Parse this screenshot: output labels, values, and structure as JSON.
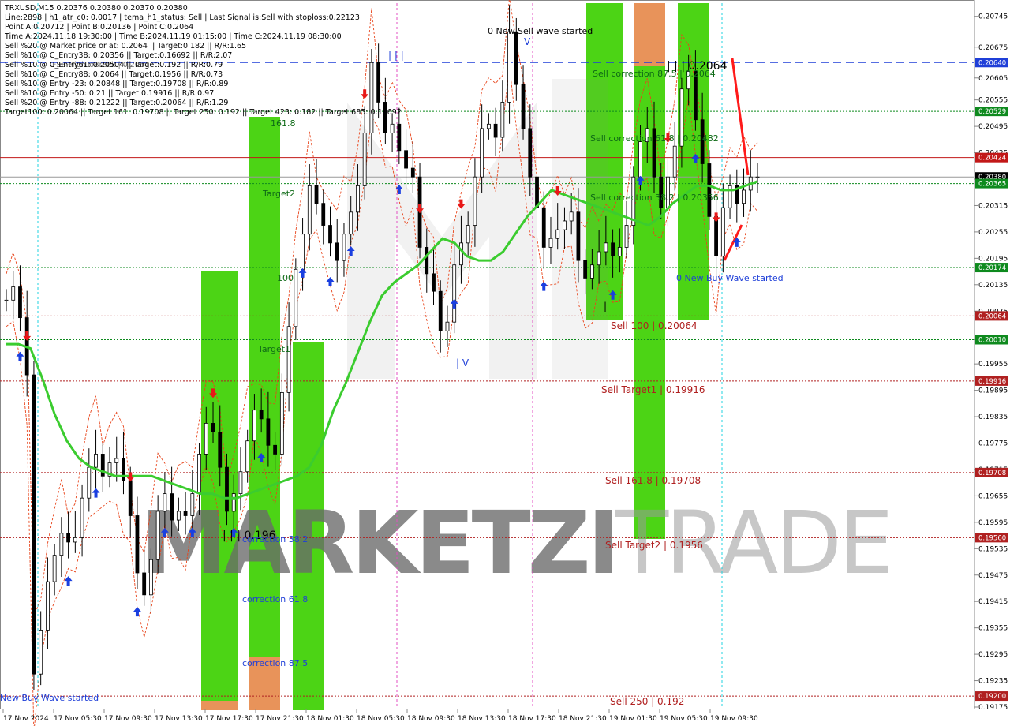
{
  "header": {
    "symbol_line": "TRXUSD,M15  0.20376 0.20380 0.20370 0.20380",
    "info_lines": [
      "Line:2898 | h1_atr_c0: 0.0017 | tema_h1_status: Sell | Last Signal is:Sell with stoploss:0.22123",
      "Point A:0.20712 | Point B:0.20136 | Point C:0.2064",
      "Time A:2024.11.18 19:30:00 | Time B:2024.11.19 01:15:00 | Time C:2024.11.19 08:30:00",
      "Sell %20 @ Market price or at: 0.2064 || Target:0.182 || R/R:1.65",
      "Sell %10 @ C_Entry38: 0.20356 || Target:0.16692 || R/R:2.07",
      "Sell %10 @ C_Entry61: 0.20504 || Target:0.192 || R/R:0.79",
      "Sell %10 @ C_Entry88: 0.2064 || Target:0.1956 || R/R:0.73",
      "Sell %10 @ Entry -23: 0.20848 || Target:0.19708 || R/R:0.89",
      "Sell %10 @ Entry -50: 0.21 || Target:0.19916 || R/R:0.97",
      "Sell %20 @ Entry -88: 0.21222 || Target:0.20064 || R/R:1.29",
      "Target100: 0.20064 || Target 161: 0.19708 || Target 250: 0.192 || Target 423: 0.182 || Target 685: 0.16692"
    ],
    "overlap_text": "FSB-HighToBreak | 0.2064"
  },
  "watermark": {
    "part1": "MARKETZI",
    "part2": "TRADE"
  },
  "colors": {
    "green_zone": "#4cd415",
    "orange_zone": "#e8935a",
    "ema": "#3bcc2f",
    "envelope": "#e8441a",
    "blue_level": "#1f3fd8",
    "red_level": "#c21818",
    "green_level": "#0e8a1e",
    "dark_red_level": "#b02020"
  },
  "price_axis_labels": [
    "0.20745",
    "0.20675",
    "0.20605",
    "0.20555",
    "0.20495",
    "0.20435",
    "0.20375",
    "0.20315",
    "0.20255",
    "0.20195",
    "0.20135",
    "0.20075",
    "0.20010",
    "0.19955",
    "0.19895",
    "0.19835",
    "0.19775",
    "0.19715",
    "0.19655",
    "0.19595",
    "0.19535",
    "0.19475",
    "0.19415",
    "0.19355",
    "0.19295",
    "0.19235",
    "0.19175"
  ],
  "price_tags": [
    {
      "text": "0.20640",
      "price": 0.2064,
      "color": "#1f3fd8"
    },
    {
      "text": "0.20529",
      "price": 0.20529,
      "color": "#0e8a1e"
    },
    {
      "text": "0.20424",
      "price": 0.20424,
      "color": "#c21818"
    },
    {
      "text": "0.20380",
      "price": 0.2038,
      "color": "#000000"
    },
    {
      "text": "0.20365",
      "price": 0.20365,
      "color": "#0e8a1e"
    },
    {
      "text": "0.20174",
      "price": 0.20174,
      "color": "#0e8a1e"
    },
    {
      "text": "0.20064",
      "price": 0.20064,
      "color": "#b02020"
    },
    {
      "text": "0.20010",
      "price": 0.2001,
      "color": "#0e8a1e"
    },
    {
      "text": "0.19916",
      "price": 0.19916,
      "color": "#b02020"
    },
    {
      "text": "0.19708",
      "price": 0.19708,
      "color": "#b02020"
    },
    {
      "text": "0.19560",
      "price": 0.1956,
      "color": "#b02020"
    },
    {
      "text": "0.19200",
      "price": 0.192,
      "color": "#b02020"
    }
  ],
  "time_labels": [
    "17 Nov 2024",
    "17 Nov 05:30",
    "17 Nov 09:30",
    "17 Nov 13:30",
    "17 Nov 17:30",
    "17 Nov 21:30",
    "18 Nov 01:30",
    "18 Nov 05:30",
    "18 Nov 09:30",
    "18 Nov 13:30",
    "18 Nov 17:30",
    "18 Nov 21:30",
    "19 Nov 01:30",
    "19 Nov 05:30",
    "19 Nov 09:30"
  ],
  "annotations": {
    "new_sell_wave": "0 New Sell wave started",
    "sell_corr_875": "Sell correction 87.5 | 0.2064",
    "sell_corr_618": "Sell correction 61.8 | 0.20482",
    "sell_corr_382": "Sell correction 38.2 | 0.20356",
    "point_c_label": "| | | 0.2064",
    "new_buy_wave": "0 New Buy Wave started",
    "sell_100": "Sell 100 | 0.20064",
    "sell_target1": "Sell Target1 | 0.19916",
    "sell_1618": "Sell 161.8 | 0.19708",
    "sell_target2": "Sell Target2 | 0.1956",
    "sell_250": "Sell 250 | 0.192",
    "left_1618": "161.8",
    "left_target2": "Target2",
    "left_100": "100",
    "left_target1": "Target1",
    "left_0196": "| | | 0.196",
    "corr_382": "correction 38.2",
    "corr_618": "correction 61.8",
    "corr_875": "correction 87.5",
    "new_buy_wave_left": "New Buy Wave started",
    "bar_ticks_top": "| | |",
    "bar_ticks_low": "| V",
    "bar_tick_single": "|",
    "sell_wave_v": "V"
  },
  "chart_data": {
    "type": "candlestick",
    "symbol": "TRXUSD",
    "timeframe": "M15",
    "ylim": [
      0.19175,
      0.20775
    ],
    "x_ticks": [
      "17 Nov 2024",
      "17 Nov 05:30",
      "17 Nov 09:30",
      "17 Nov 13:30",
      "17 Nov 17:30",
      "17 Nov 21:30",
      "18 Nov 01:30",
      "18 Nov 05:30",
      "18 Nov 09:30",
      "18 Nov 13:30",
      "18 Nov 17:30",
      "18 Nov 21:30",
      "19 Nov 01:30",
      "19 Nov 05:30",
      "19 Nov 09:30"
    ],
    "levels": [
      {
        "price": 0.2064,
        "style": "dashed",
        "color": "#1f3fd8"
      },
      {
        "price": 0.20529,
        "style": "dotted",
        "color": "#0e8a1e"
      },
      {
        "price": 0.20424,
        "style": "solid",
        "color": "#c21818"
      },
      {
        "price": 0.2038,
        "style": "solid",
        "color": "#999999"
      },
      {
        "price": 0.20365,
        "style": "dotted",
        "color": "#0e8a1e"
      },
      {
        "price": 0.20174,
        "style": "dotted",
        "color": "#0e8a1e"
      },
      {
        "price": 0.20064,
        "style": "dotted",
        "color": "#b02020"
      },
      {
        "price": 0.2001,
        "style": "dotted",
        "color": "#0e8a1e"
      },
      {
        "price": 0.19916,
        "style": "dotted",
        "color": "#b02020"
      },
      {
        "price": 0.19708,
        "style": "dotted",
        "color": "#b02020"
      },
      {
        "price": 0.1956,
        "style": "dotted",
        "color": "#b02020"
      },
      {
        "price": 0.192,
        "style": "dotted",
        "color": "#b02020"
      }
    ],
    "close_series": [
      0.201,
      0.2013,
      0.2006,
      0.1993,
      0.1925,
      0.1935,
      0.1946,
      0.1952,
      0.1957,
      0.1955,
      0.1956,
      0.1965,
      0.1972,
      0.1975,
      0.197,
      0.1973,
      0.1974,
      0.1969,
      0.1961,
      0.1948,
      0.1943,
      0.1951,
      0.1962,
      0.1966,
      0.196,
      0.1962,
      0.1961,
      0.1966,
      0.1975,
      0.1982,
      0.198,
      0.1972,
      0.1962,
      0.1966,
      0.1971,
      0.1978,
      0.1985,
      0.1983,
      0.1977,
      0.1975,
      0.1989,
      0.2004,
      0.2017,
      0.2025,
      0.2036,
      0.2032,
      0.2027,
      0.2023,
      0.2019,
      0.2025,
      0.203,
      0.2036,
      0.2048,
      0.2064,
      0.2055,
      0.2048,
      0.205,
      0.2044,
      0.204,
      0.2038,
      0.2022,
      0.2016,
      0.2012,
      0.2003,
      0.2005,
      0.2018,
      0.2023,
      0.2027,
      0.2038,
      0.2049,
      0.205,
      0.2047,
      0.2055,
      0.2071,
      0.2059,
      0.2049,
      0.2038,
      0.2031,
      0.2022,
      0.2024,
      0.2026,
      0.2028,
      0.203,
      0.2019,
      0.2015,
      0.2018,
      0.2021,
      0.2023,
      0.202,
      0.2022,
      0.2027,
      0.2038,
      0.2046,
      0.2049,
      0.2038,
      0.2031,
      0.2038,
      0.2045,
      0.2058,
      0.2062,
      0.2051,
      0.2041,
      0.2029,
      0.202,
      0.2031,
      0.2036,
      0.2032,
      0.2035,
      0.2038,
      0.2038
    ],
    "ema_series": [
      0.2,
      0.2,
      0.1999,
      0.1992,
      0.1984,
      0.1978,
      0.1974,
      0.1972,
      0.1971,
      0.197,
      0.197,
      0.197,
      0.197,
      0.1969,
      0.1968,
      0.1967,
      0.1966,
      0.1966,
      0.1965,
      0.1965,
      0.1966,
      0.1967,
      0.1968,
      0.1969,
      0.197,
      0.1972,
      0.1977,
      0.1985,
      0.1991,
      0.1998,
      0.2005,
      0.2011,
      0.2014,
      0.2016,
      0.2018,
      0.2021,
      0.2024,
      0.2023,
      0.202,
      0.2019,
      0.2019,
      0.2021,
      0.2025,
      0.2029,
      0.2032,
      0.2035,
      0.2034,
      0.2033,
      0.2032,
      0.2031,
      0.203,
      0.2029,
      0.2028,
      0.2027,
      0.2029,
      0.2032,
      0.2034,
      0.2036,
      0.2036,
      0.2035,
      0.2035,
      0.2036,
      0.2037
    ]
  }
}
